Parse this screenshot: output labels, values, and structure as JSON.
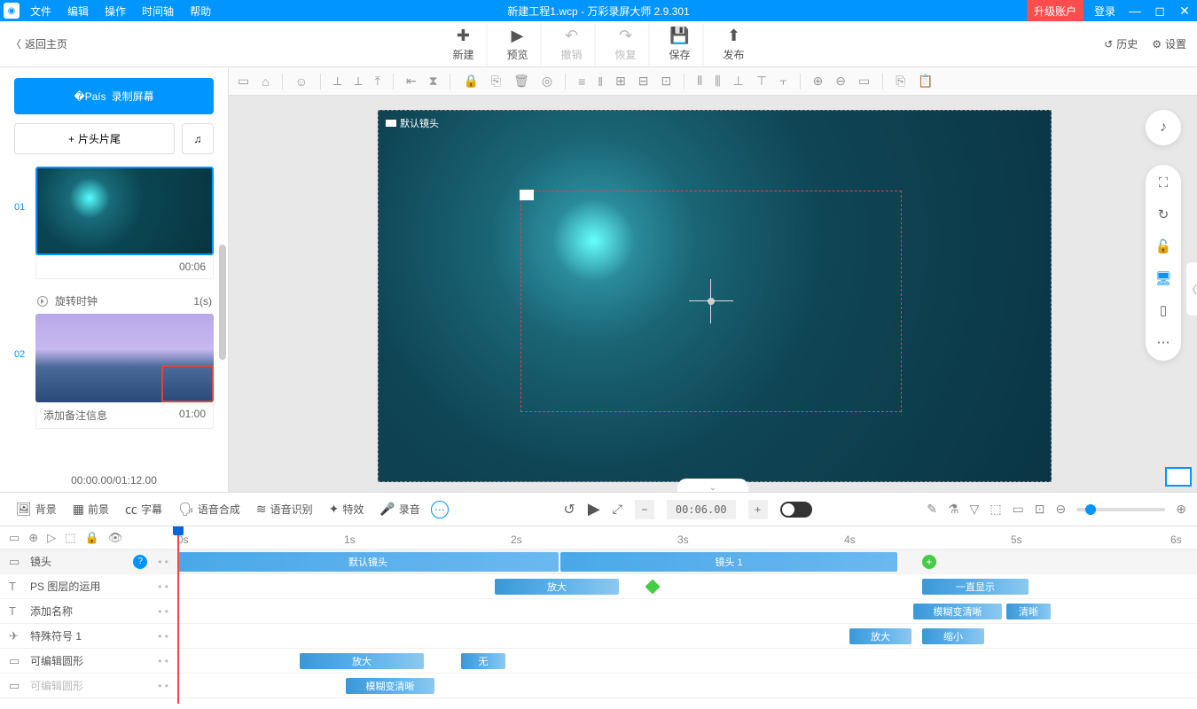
{
  "titlebar": {
    "file": "文件",
    "edit": "编辑",
    "action": "操作",
    "timeline": "时间轴",
    "help": "帮助",
    "title": "新建工程1.wcp - 万彩录屏大师 2.9.301",
    "upgrade": "升级账户",
    "login": "登录"
  },
  "back": "返回主页",
  "toolbar": {
    "new": "新建",
    "preview": "预览",
    "undo": "撤销",
    "redo": "恢复",
    "save": "保存",
    "publish": "发布",
    "history": "历史",
    "settings": "设置"
  },
  "sidebar": {
    "record": "录制屏幕",
    "titleclip": "片头片尾",
    "clip1": {
      "num": "01",
      "time": "00:06"
    },
    "trans": {
      "name": "旋转时钟",
      "dur": "1(s)"
    },
    "clip2": {
      "num": "02",
      "note": "添加备注信息",
      "time": "01:00"
    },
    "total": "00:00.00/01:12.00"
  },
  "stage": {
    "label": "默认镜头"
  },
  "bottombar": {
    "bg": "背景",
    "fg": "前景",
    "sub": "字幕",
    "tts": "语音合成",
    "asr": "语音识别",
    "fx": "特效",
    "rec": "录音",
    "time": "00:06.00"
  },
  "ruler": {
    "t0": "0s",
    "t1": "1s",
    "t2": "2s",
    "t3": "3s",
    "t4": "4s",
    "t5": "5s",
    "t6": "6s"
  },
  "tracks": {
    "t0": {
      "name": "镜头",
      "seg1": "默认镜头",
      "seg2": "镜头 1"
    },
    "t1": {
      "name": "PS 图层的运用",
      "seg1": "放大",
      "seg2": "一直显示"
    },
    "t2": {
      "name": "添加名称",
      "seg1": "模糊变清晰",
      "seg2": "清晰"
    },
    "t3": {
      "name": "特殊符号 1",
      "seg1": "放大",
      "seg2": "缩小"
    },
    "t4": {
      "name": "可编辑圆形",
      "seg1": "放大",
      "seg2": "无"
    },
    "t5": {
      "name": "可编辑圆形",
      "seg1": "模糊变清晰"
    }
  }
}
